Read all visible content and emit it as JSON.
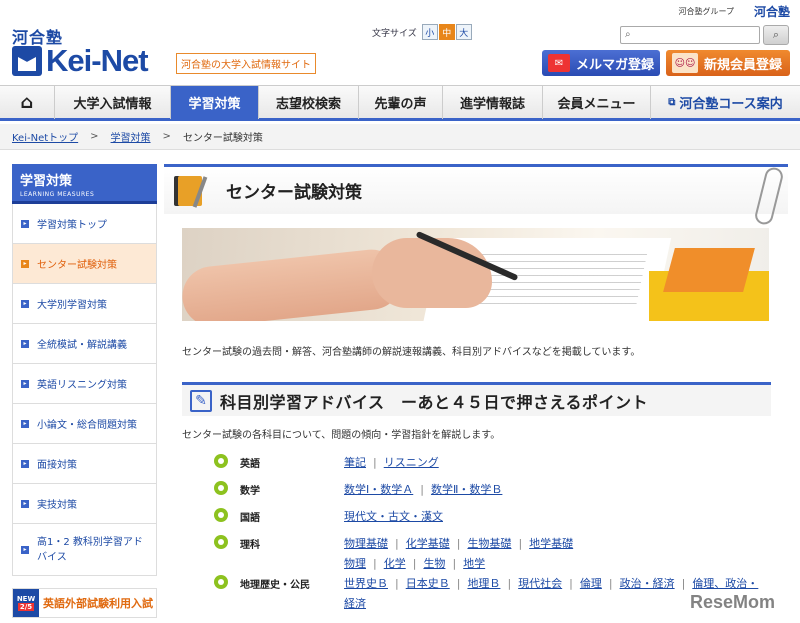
{
  "topbar": {
    "group": "河合塾グループ",
    "brand": "河合塾"
  },
  "header": {
    "logo_kanji": "河合塾",
    "logo_text": "Kei-Net",
    "tagline": "河合塾の大学入試情報サイト",
    "font_size_label": "文字サイズ",
    "font_sizes": [
      "小",
      "中",
      "大"
    ],
    "search_placeholder": "",
    "mail_button": "メルマガ登録",
    "join_button": "新規会員登録"
  },
  "nav": {
    "items": [
      "大学入試情報",
      "学習対策",
      "志望校検索",
      "先輩の声",
      "進学情報誌",
      "会員メニュー"
    ],
    "course": "河合塾コース案内"
  },
  "breadcrumb": {
    "items": [
      "Kei-Netトップ",
      "学習対策",
      "センター試験対策"
    ],
    "separator": ">"
  },
  "sidebar": {
    "title": "学習対策",
    "subtitle": "LEARNING MEASURES",
    "items": [
      "学習対策トップ",
      "センター試験対策",
      "大学別学習対策",
      "全統模試・解説講義",
      "英語リスニング対策",
      "小論文・総合問題対策",
      "面接対策",
      "実技対策",
      "高1・2 教科別学習アドバイス"
    ],
    "banner": {
      "new": "NEW",
      "date": "2/5",
      "text": "英語外部試験利用入試"
    }
  },
  "main": {
    "title": "センター試験対策",
    "intro": "センター試験の過去問・解答、河合塾講師の解説速報講義、科目別アドバイスなどを掲載しています。",
    "section_title": "科目別学習アドバイス　ーあと４５日で押さえるポイント",
    "section_desc": "センター試験の各科目について、問題の傾向・学習指針を解説します。",
    "subjects": [
      {
        "name": "英語",
        "links": [
          "筆記",
          "リスニング"
        ]
      },
      {
        "name": "数学",
        "links": [
          "数学Ⅰ・数学Ａ",
          "数学Ⅱ・数学Ｂ"
        ]
      },
      {
        "name": "国語",
        "links": [
          "現代文・古文・漢文"
        ]
      },
      {
        "name": "理科",
        "links": [
          "物理基礎",
          "化学基礎",
          "生物基礎",
          "地学基礎",
          "物理",
          "化学",
          "生物",
          "地学"
        ]
      },
      {
        "name": "地理歴史・公民",
        "links": [
          "世界史Ｂ",
          "日本史Ｂ",
          "地理Ｂ",
          "現代社会",
          "倫理",
          "政治・経済",
          "倫理、政治・経済"
        ]
      }
    ]
  },
  "watermark": "ReseMom"
}
